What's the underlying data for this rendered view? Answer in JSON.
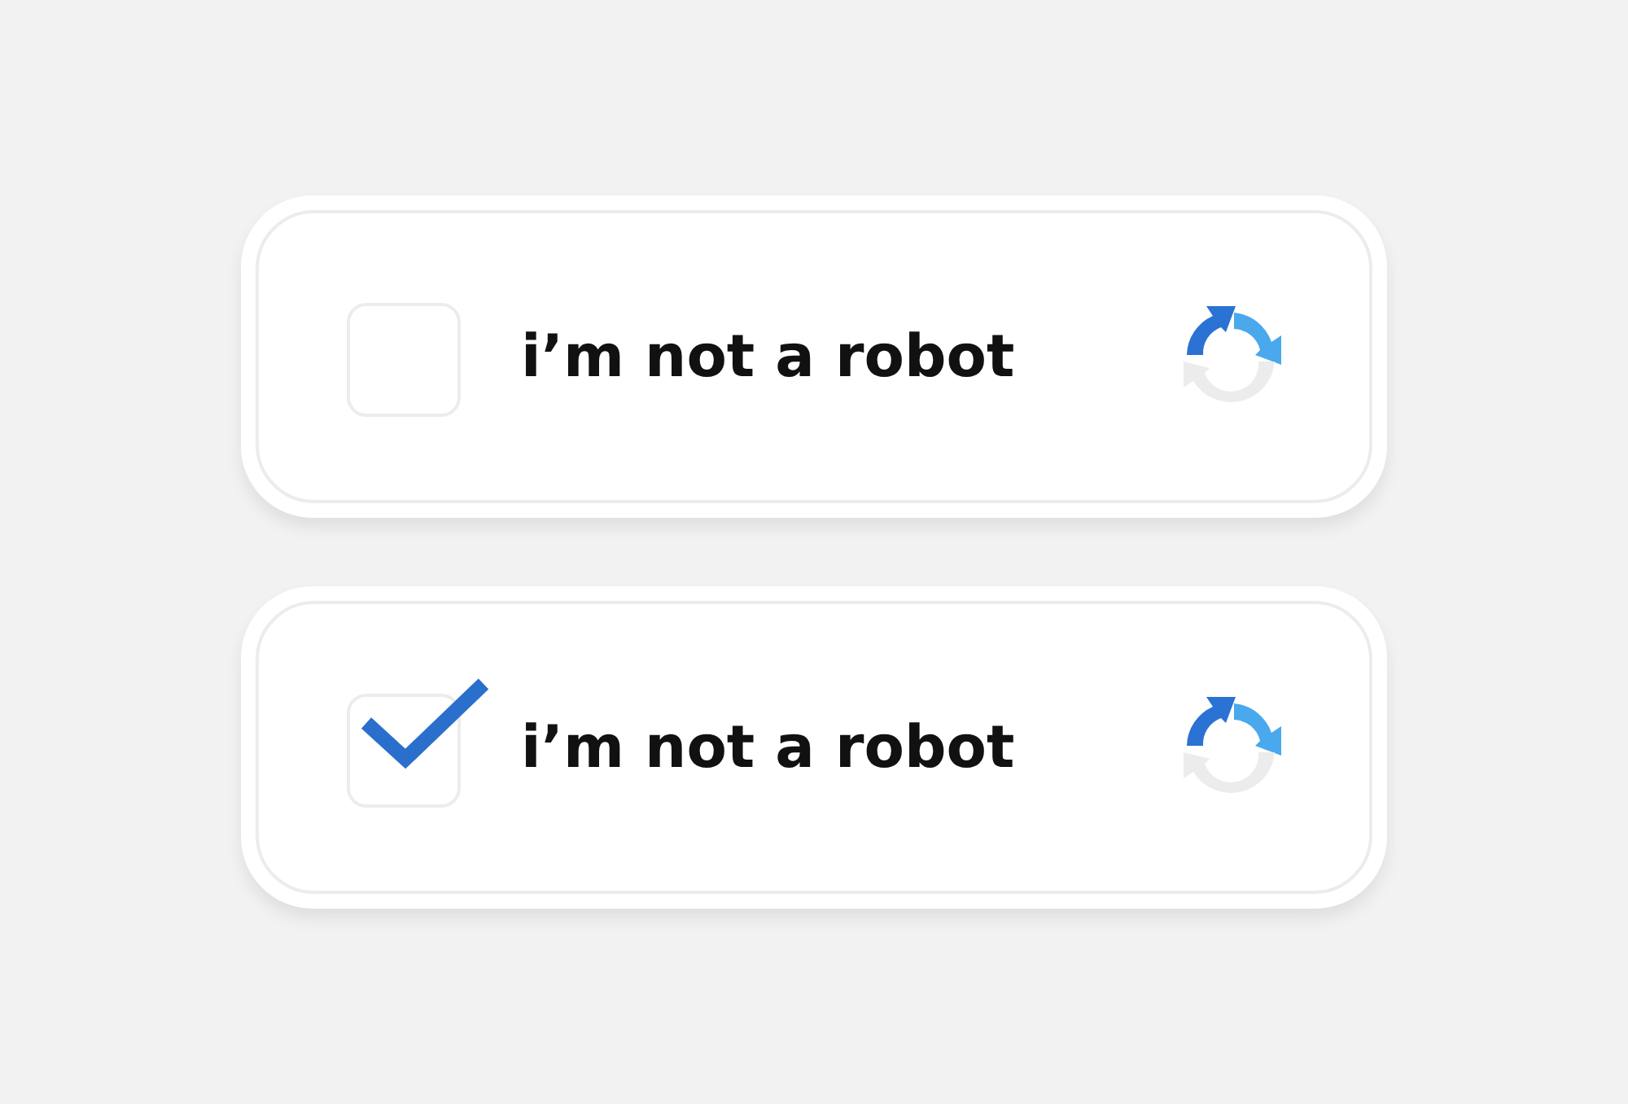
{
  "captchas": [
    {
      "label": "i’m not a robot",
      "checked": false
    },
    {
      "label": "i’m not a robot",
      "checked": true
    }
  ]
}
